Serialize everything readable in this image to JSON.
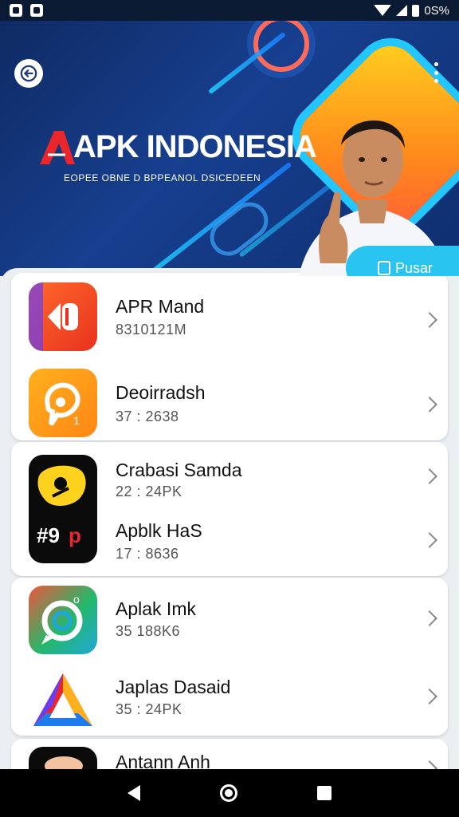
{
  "status_bar": {
    "battery_text": "0S%"
  },
  "hero": {
    "brand_title": "APK INDONESIA",
    "brand_subtitle": "EOPEE OBNE D BPPEANOL DSICEDEEN",
    "pusar_label": "Pusar"
  },
  "apps": [
    {
      "name": "APR Mand",
      "sub": "8310121M"
    },
    {
      "name": "Deoirradsh",
      "sub": "37 : 2638"
    },
    {
      "name": "Crabasi Samda",
      "sub": "22 : 24PK"
    },
    {
      "name": "Apblk HaS",
      "sub": "17 : 8636"
    },
    {
      "name": "Aplak Imk",
      "sub": "35 188K6"
    },
    {
      "name": "Japlas Dasaid",
      "sub": "35 : 24PK"
    },
    {
      "name": "Antann Anh",
      "sub": ""
    }
  ],
  "icons": {
    "back": "back-arrow-icon",
    "menu": "more-vert-icon",
    "pusar": "bag-icon",
    "chevron": "chevron-right-icon"
  },
  "colors": {
    "hero_bg": "#173f8f",
    "accent_cyan": "#29c4f0",
    "accent_orange": "#ff8a1c",
    "logo_red": "#e8262b"
  }
}
